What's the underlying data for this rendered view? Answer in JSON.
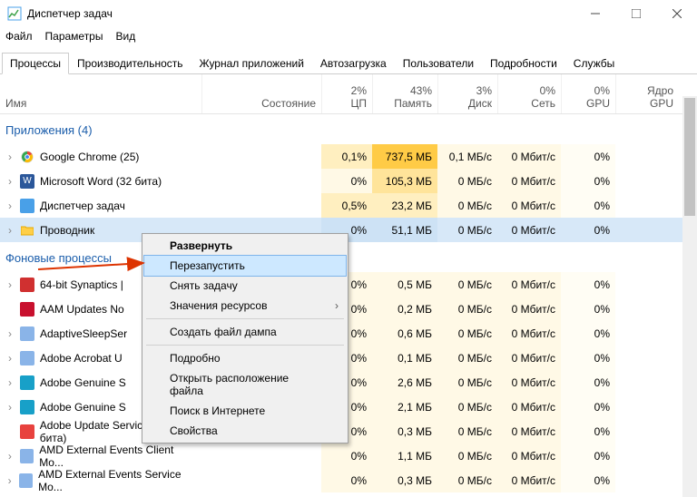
{
  "window": {
    "title": "Диспетчер задач"
  },
  "menu": {
    "file": "Файл",
    "options": "Параметры",
    "view": "Вид"
  },
  "tabs": {
    "items": [
      "Процессы",
      "Производительность",
      "Журнал приложений",
      "Автозагрузка",
      "Пользователи",
      "Подробности",
      "Службы"
    ],
    "active": 0
  },
  "columns": {
    "name": "Имя",
    "state": "Состояние",
    "cpu": {
      "pct": "2%",
      "label": "ЦП"
    },
    "mem": {
      "pct": "43%",
      "label": "Память"
    },
    "disk": {
      "pct": "3%",
      "label": "Диск"
    },
    "net": {
      "pct": "0%",
      "label": "Сеть"
    },
    "gpu": {
      "pct": "0%",
      "label": "GPU"
    },
    "gpucore": {
      "label": "Ядро GPU"
    }
  },
  "groups": {
    "apps": "Приложения (4)",
    "bg": "Фоновые процессы"
  },
  "rows": {
    "apps": [
      {
        "icon": "chrome",
        "name": "Google Chrome (25)",
        "cpu": "0,1%",
        "mem": "737,5 МБ",
        "disk": "0,1 МБ/с",
        "net": "0 Мбит/с",
        "gpu": "0%",
        "memHeat": "hm",
        "exp": true
      },
      {
        "icon": "word",
        "name": "Microsoft Word (32 бита)",
        "cpu": "0%",
        "mem": "105,3 МБ",
        "disk": "0 МБ/с",
        "net": "0 Мбит/с",
        "gpu": "0%",
        "memHeat": "h2",
        "exp": true
      },
      {
        "icon": "tm",
        "name": "Диспетчер задач",
        "cpu": "0,5%",
        "mem": "23,2 МБ",
        "disk": "0 МБ/с",
        "net": "0 Мбит/с",
        "gpu": "0%",
        "memHeat": "h1",
        "exp": true
      },
      {
        "icon": "explorer",
        "name": "Проводник",
        "cpu": "0%",
        "mem": "51,1 МБ",
        "disk": "0 МБ/с",
        "net": "0 Мбит/с",
        "gpu": "0%",
        "memHeat": "h1",
        "exp": true,
        "selected": true
      }
    ],
    "bg": [
      {
        "icon": "syn",
        "name": "64-bit Synaptics |",
        "cpu": "0%",
        "mem": "0,5 МБ",
        "disk": "0 МБ/с",
        "net": "0 Мбит/с",
        "gpu": "0%",
        "exp": true
      },
      {
        "icon": "adobe",
        "name": "AAM Updates No",
        "cpu": "0%",
        "mem": "0,2 МБ",
        "disk": "0 МБ/с",
        "net": "0 Мбит/с",
        "gpu": "0%"
      },
      {
        "icon": "svc",
        "name": "AdaptiveSleepSer",
        "cpu": "0%",
        "mem": "0,6 МБ",
        "disk": "0 МБ/с",
        "net": "0 Мбит/с",
        "gpu": "0%",
        "exp": true
      },
      {
        "icon": "svc",
        "name": "Adobe Acrobat U",
        "cpu": "0%",
        "mem": "0,1 МБ",
        "disk": "0 МБ/с",
        "net": "0 Мбит/с",
        "gpu": "0%",
        "exp": true
      },
      {
        "icon": "ags",
        "name": "Adobe Genuine S",
        "cpu": "0%",
        "mem": "2,6 МБ",
        "disk": "0 МБ/с",
        "net": "0 Мбит/с",
        "gpu": "0%",
        "exp": true
      },
      {
        "icon": "ags",
        "name": "Adobe Genuine S",
        "cpu": "0%",
        "mem": "2,1 МБ",
        "disk": "0 МБ/с",
        "net": "0 Мбит/с",
        "gpu": "0%",
        "exp": true
      },
      {
        "icon": "au",
        "name": "Adobe Update Service (32 бита)",
        "cpu": "0%",
        "mem": "0,3 МБ",
        "disk": "0 МБ/с",
        "net": "0 Мбит/с",
        "gpu": "0%"
      },
      {
        "icon": "svc",
        "name": "AMD External Events Client Mo...",
        "cpu": "0%",
        "mem": "1,1 МБ",
        "disk": "0 МБ/с",
        "net": "0 Мбит/с",
        "gpu": "0%",
        "exp": true
      },
      {
        "icon": "svc",
        "name": "AMD External Events Service Mo...",
        "cpu": "0%",
        "mem": "0,3 МБ",
        "disk": "0 МБ/с",
        "net": "0 Мбит/с",
        "gpu": "0%",
        "exp": true
      }
    ]
  },
  "context_menu": {
    "items": [
      {
        "label": "Развернуть",
        "bold": true
      },
      {
        "label": "Перезапустить",
        "selected": true
      },
      {
        "label": "Снять задачу"
      },
      {
        "label": "Значения ресурсов",
        "submenu": true
      },
      {
        "sep": true
      },
      {
        "label": "Создать файл дампа"
      },
      {
        "sep": true
      },
      {
        "label": "Подробно"
      },
      {
        "label": "Открыть расположение файла"
      },
      {
        "label": "Поиск в Интернете"
      },
      {
        "label": "Свойства"
      }
    ]
  }
}
